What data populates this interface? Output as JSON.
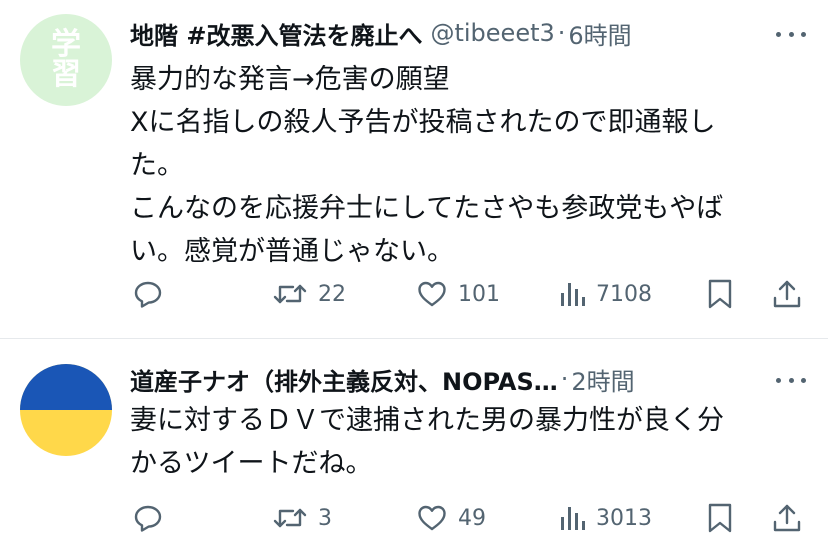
{
  "tweets": [
    {
      "avatar": {
        "glyph_top": "学",
        "glyph_bottom": "習",
        "bg": "#d9f3d7"
      },
      "name": "地階 #改悪入管法を廃止へ",
      "handle": "@tibeeet3",
      "separator": "·",
      "time": "6時間",
      "lines": [
        "暴力的な発言→危害の願望",
        "Xに名指しの殺人予告が投稿されたので即通報し",
        "た。",
        "こんなのを応援弁士にしてたさやも参政党もやば",
        "い。感覚が普通じゃない。"
      ],
      "stats": {
        "reposts": "22",
        "likes": "101",
        "views": "7108"
      }
    },
    {
      "avatar": {
        "top_color": "#1a56b6",
        "bottom_color": "#ffd84a"
      },
      "name": "道産子ナオ（排外主義反対、NOPAS…",
      "separator": "·",
      "time": "2時間",
      "lines": [
        "妻に対するＤＶで逮捕された男の暴力性が良く分",
        "かるツイートだね。"
      ],
      "stats": {
        "reposts": "3",
        "likes": "49",
        "views": "3013"
      }
    }
  ],
  "icons": [
    "reply-icon",
    "retweet-icon",
    "like-icon",
    "views-icon",
    "bookmark-icon",
    "share-icon",
    "more-icon"
  ],
  "colors": {
    "text": "#0f1419",
    "secondary": "#536471",
    "divider": "#e6e9ec"
  }
}
